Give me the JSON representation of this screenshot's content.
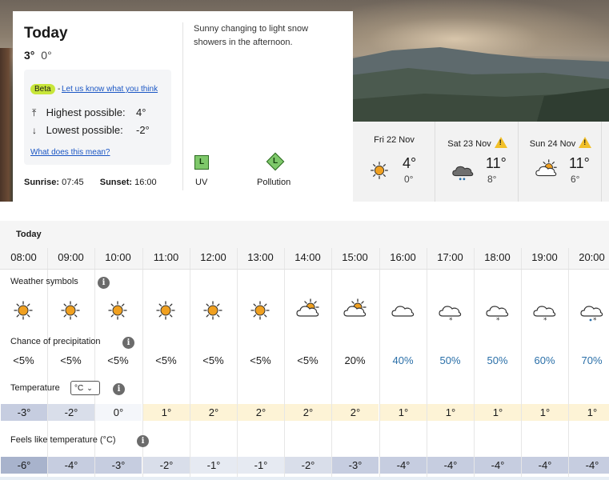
{
  "today": {
    "title": "Today",
    "high": "3°",
    "low": "0°",
    "beta_badge": "Beta",
    "beta_separator": "-",
    "beta_link": "Let us know what you think",
    "highest_label": "Highest possible:",
    "highest_value": "4°",
    "lowest_label": "Lowest possible:",
    "lowest_value": "-2°",
    "what_link": "What does this mean?",
    "sunrise_label": "Sunrise:",
    "sunrise_value": "07:45",
    "sunset_label": "Sunset:",
    "sunset_value": "16:00",
    "description": "Sunny changing to light snow showers in the afternoon.",
    "uv_level": "L",
    "uv_label": "UV",
    "pollution_level": "L",
    "pollution_label": "Pollution",
    "level_color": "#7ec86a"
  },
  "days": [
    {
      "name": "Fri 22 Nov",
      "icon": "sun-icon",
      "high": "4°",
      "low": "0°",
      "warning": false
    },
    {
      "name": "Sat 23 Nov",
      "icon": "heavy-rain-cloud-icon",
      "high": "11°",
      "low": "8°",
      "warning": true
    },
    {
      "name": "Sun 24 Nov",
      "icon": "sun-cloud-icon",
      "high": "11°",
      "low": "6°",
      "warning": true
    }
  ],
  "hourly": {
    "title": "Today",
    "weather_label": "Weather symbols",
    "precip_label": "Chance of precipitation",
    "temp_label": "Temperature",
    "unit_value": "°C",
    "feels_label": "Feels like temperature (°C)",
    "info_glyph": "i",
    "hours": [
      {
        "time": "08:00",
        "icon": "sun-icon",
        "precip": "<5%",
        "temp": "-3°",
        "feels": "-6°"
      },
      {
        "time": "09:00",
        "icon": "sun-icon",
        "precip": "<5%",
        "temp": "-2°",
        "feels": "-4°"
      },
      {
        "time": "10:00",
        "icon": "sun-icon",
        "precip": "<5%",
        "temp": "0°",
        "feels": "-3°"
      },
      {
        "time": "11:00",
        "icon": "sun-icon",
        "precip": "<5%",
        "temp": "1°",
        "feels": "-2°"
      },
      {
        "time": "12:00",
        "icon": "sun-icon",
        "precip": "<5%",
        "temp": "2°",
        "feels": "-1°"
      },
      {
        "time": "13:00",
        "icon": "sun-icon",
        "precip": "<5%",
        "temp": "2°",
        "feels": "-1°"
      },
      {
        "time": "14:00",
        "icon": "sun-cloud-icon",
        "precip": "<5%",
        "temp": "2°",
        "feels": "-2°"
      },
      {
        "time": "15:00",
        "icon": "sun-cloud-icon",
        "precip": "20%",
        "temp": "2°",
        "feels": "-3°"
      },
      {
        "time": "16:00",
        "icon": "cloud-icon",
        "precip": "40%",
        "temp": "1°",
        "feels": "-4°"
      },
      {
        "time": "17:00",
        "icon": "snow-cloud-icon",
        "precip": "50%",
        "temp": "1°",
        "feels": "-4°"
      },
      {
        "time": "18:00",
        "icon": "snow-cloud-icon",
        "precip": "50%",
        "temp": "1°",
        "feels": "-4°"
      },
      {
        "time": "19:00",
        "icon": "snow-cloud-icon",
        "precip": "60%",
        "temp": "1°",
        "feels": "-4°"
      },
      {
        "time": "20:00",
        "icon": "sleet-cloud-icon",
        "precip": "70%",
        "temp": "1°",
        "feels": "-4°"
      }
    ]
  },
  "colors": {
    "link": "#1a56c4",
    "precip_high": "#2a6fa8",
    "sun_orange": "#f0a020",
    "warning_yellow": "#f2c029",
    "beta_green": "#c8e63a"
  }
}
